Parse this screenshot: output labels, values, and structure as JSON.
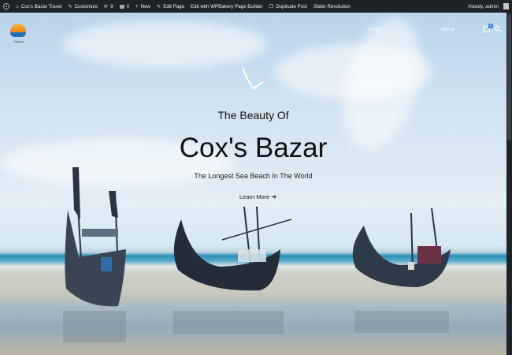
{
  "adminbar": {
    "site_name": "Cox's Bazar Travel",
    "customize": "Customize",
    "updates_count": "9",
    "comments_count": "0",
    "new_label": "New",
    "edit_page": "Edit Page",
    "wpbakery": "Edit with WPBakery Page Builder",
    "duplicate": "Duplicate Post",
    "slider": "Slider Revolution",
    "howdy": "Howdy, admin"
  },
  "header": {
    "logo_text": "Nature",
    "nav": [
      "Tours",
      "",
      "About"
    ],
    "cart_count": "0"
  },
  "hero": {
    "subtitle": "The Beauty Of",
    "title": "Cox's Bazar",
    "tagline": "The Longest Sea Beach In The World",
    "cta_label": "Learn More",
    "cta_arrow": "➔"
  },
  "colors": {
    "adminbar_bg": "#1d2327",
    "sky_light": "#e3eef6",
    "sea": "#2c8fb3",
    "boat": "#2b3440"
  }
}
